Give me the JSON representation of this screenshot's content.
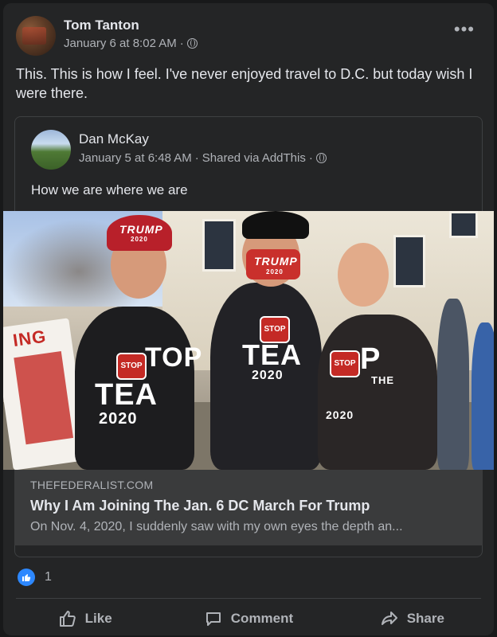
{
  "post": {
    "author": "Tom Tanton",
    "timestamp": "January 6 at 8:02 AM",
    "meta_separator": "·",
    "text": "This. This is how I feel. I've never enjoyed travel to D.C. but today wish I were there.",
    "more_label": "•••"
  },
  "shared_post": {
    "author": "Dan McKay",
    "timestamp": "January 5 at 6:48 AM",
    "via": "Shared via AddThis",
    "meta_separator": "·",
    "text": "How we are where we are",
    "photo_texts": {
      "cap_left": "TRUMP",
      "cap_left_sub": "2020",
      "mask": "TRUMP",
      "mask_sub": "2020",
      "shirt_left_top": "TOP",
      "shirt_left_mid": "TEA",
      "shirt_left_year": "2020",
      "shirt_mid_top": "STOP",
      "shirt_mid_mid": "TEA",
      "shirt_mid_year": "2020",
      "shirt_right_top": "P",
      "shirt_right_the": "THE",
      "shirt_right_year": "2020",
      "stop_sign": "STOP",
      "sign_text": "ING"
    }
  },
  "link_preview": {
    "domain": "THEFEDERALIST.COM",
    "title": "Why I Am Joining The Jan. 6 DC March For Trump",
    "description": "On Nov. 4, 2020, I suddenly saw with my own eyes the depth an..."
  },
  "reactions": {
    "count": "1",
    "icon": "like-icon"
  },
  "actions": {
    "like": "Like",
    "comment": "Comment",
    "share": "Share"
  },
  "colors": {
    "background": "#18191a",
    "card": "#242526",
    "link_box": "#3a3b3c",
    "like_blue": "#2d88ff",
    "text_primary": "#e4e6eb",
    "text_secondary": "#b0b3b8"
  }
}
